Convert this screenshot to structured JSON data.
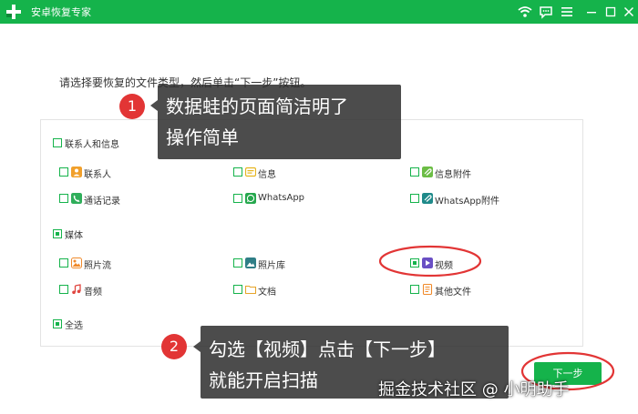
{
  "window": {
    "title": "安卓恢复专家",
    "colors": {
      "accent": "#15b34b",
      "highlight_ring": "#e23535"
    }
  },
  "instruction": "请选择要恢复的文件类型，然后单击“下一步”按钮。",
  "groups": [
    {
      "label": "联系人和信息",
      "checked": false,
      "items": [
        {
          "label": "联系人",
          "icon": "contacts-icon",
          "checked": false
        },
        {
          "label": "信息",
          "icon": "messages-icon",
          "checked": false
        },
        {
          "label": "信息附件",
          "icon": "message-attachment-icon",
          "checked": false
        },
        {
          "label": "通话记录",
          "icon": "call-log-icon",
          "checked": false
        },
        {
          "label": "WhatsApp",
          "icon": "whatsapp-icon",
          "checked": false
        },
        {
          "label": "WhatsApp附件",
          "icon": "whatsapp-attachment-icon",
          "checked": false
        }
      ]
    },
    {
      "label": "媒体",
      "checked": true,
      "items": [
        {
          "label": "照片流",
          "icon": "photo-stream-icon",
          "checked": false
        },
        {
          "label": "照片库",
          "icon": "photo-library-icon",
          "checked": false
        },
        {
          "label": "视频",
          "icon": "video-icon",
          "checked": true
        },
        {
          "label": "音频",
          "icon": "audio-icon",
          "checked": false
        },
        {
          "label": "文档",
          "icon": "document-folder-icon",
          "checked": false
        },
        {
          "label": "其他文件",
          "icon": "other-files-icon",
          "checked": false
        }
      ]
    }
  ],
  "select_all": {
    "label": "全选",
    "checked": true
  },
  "next_button": "下一步",
  "callouts": [
    {
      "badge": "1",
      "line1": "数据蛙的页面简洁明了",
      "line2": "操作简单"
    },
    {
      "badge": "2",
      "line1": "勾选【视频】点击【下一步】",
      "line2": "就能开启扫描"
    }
  ],
  "watermark": "掘金技术社区 @ 小明助手"
}
